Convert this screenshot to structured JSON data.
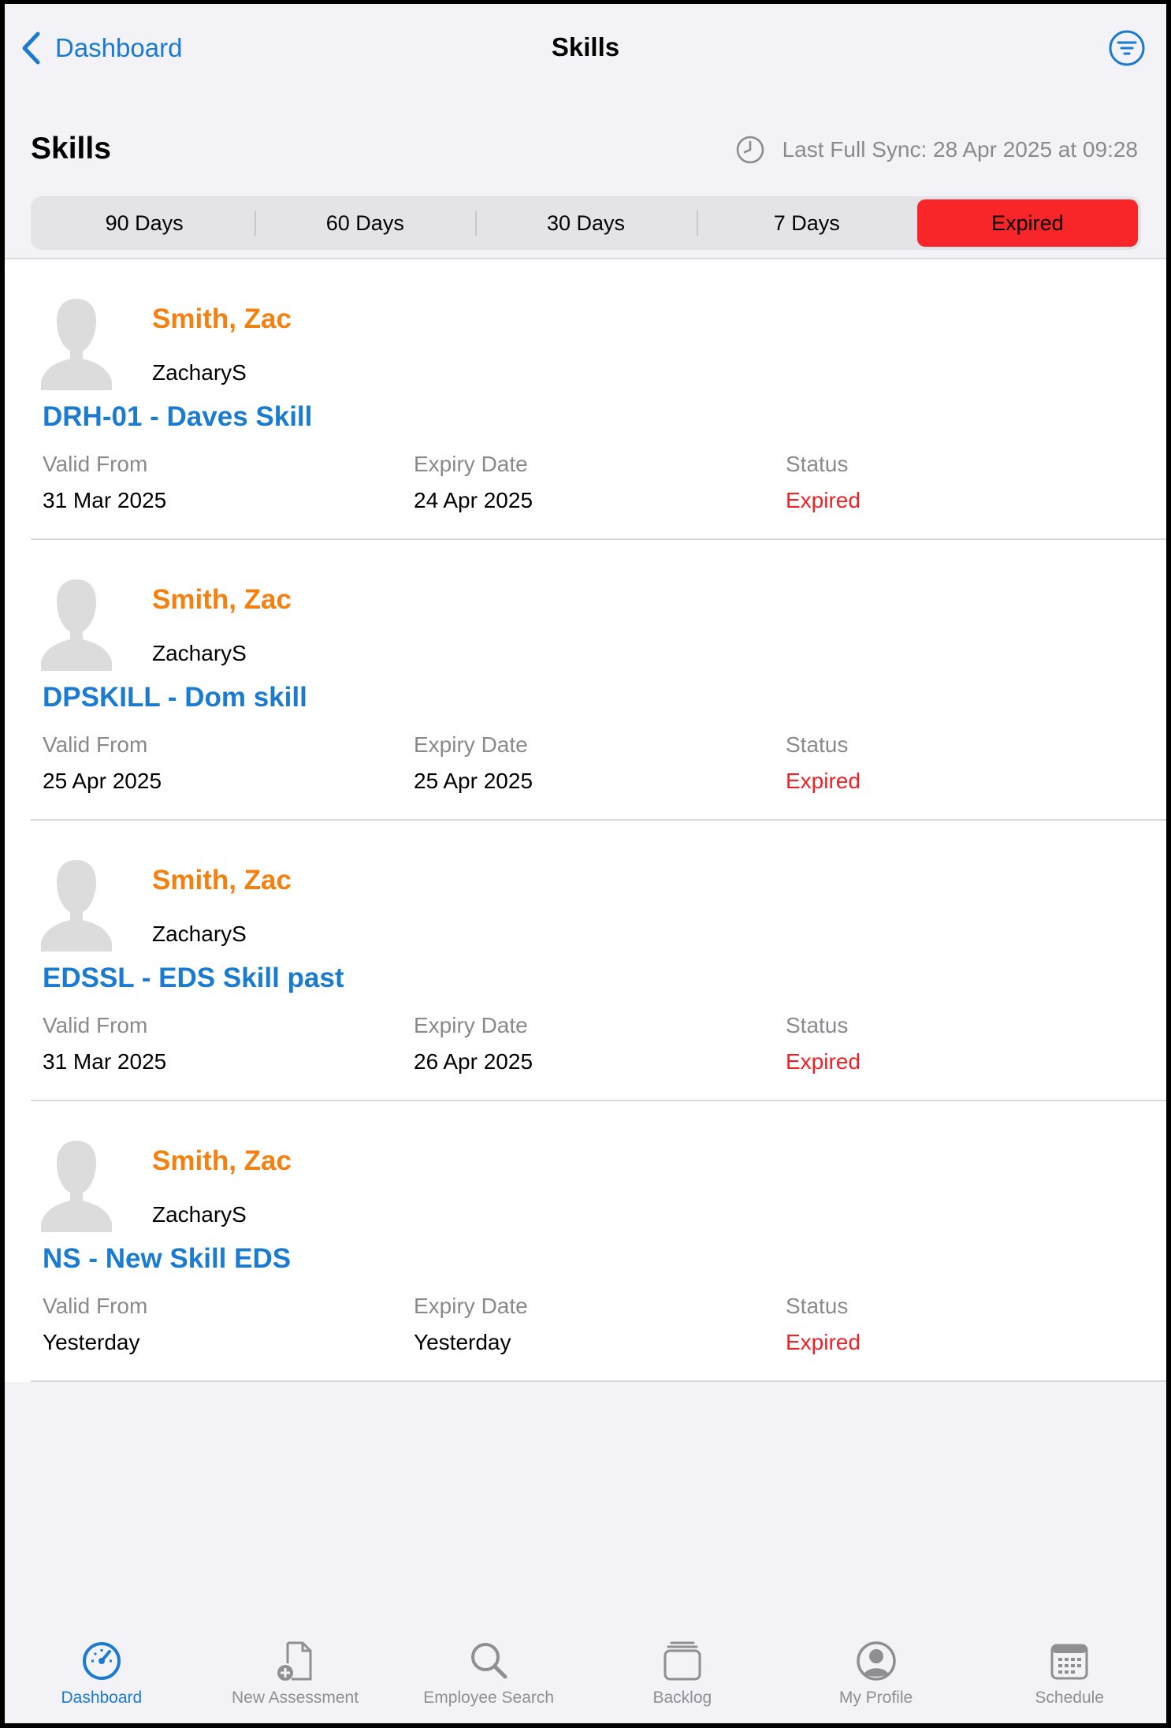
{
  "nav": {
    "back_label": "Dashboard",
    "title": "Skills"
  },
  "header": {
    "title": "Skills",
    "sync_text": "Last Full Sync: 28 Apr 2025 at 09:28"
  },
  "segments": [
    "90 Days",
    "60 Days",
    "30 Days",
    "7 Days",
    "Expired"
  ],
  "selected_segment": "Expired",
  "columns": {
    "valid_from": "Valid From",
    "expiry_date": "Expiry Date",
    "status": "Status"
  },
  "skills": [
    {
      "name": "Smith, Zac",
      "username": "ZacharyS",
      "skill": "DRH-01 - Daves Skill",
      "valid_from": "31 Mar 2025",
      "expiry": "24 Apr 2025",
      "status": "Expired"
    },
    {
      "name": "Smith, Zac",
      "username": "ZacharyS",
      "skill": "DPSKILL - Dom skill",
      "valid_from": "25 Apr 2025",
      "expiry": "25 Apr 2025",
      "status": "Expired"
    },
    {
      "name": "Smith, Zac",
      "username": "ZacharyS",
      "skill": "EDSSL - EDS Skill past",
      "valid_from": "31 Mar 2025",
      "expiry": "26 Apr 2025",
      "status": "Expired"
    },
    {
      "name": "Smith, Zac",
      "username": "ZacharyS",
      "skill": "NS - New Skill EDS",
      "valid_from": "Yesterday",
      "expiry": "Yesterday",
      "status": "Expired"
    }
  ],
  "tabs": [
    {
      "label": "Dashboard",
      "icon": "gauge-icon"
    },
    {
      "label": "New Assessment",
      "icon": "document-add-icon"
    },
    {
      "label": "Employee Search",
      "icon": "search-icon"
    },
    {
      "label": "Backlog",
      "icon": "stack-icon"
    },
    {
      "label": "My Profile",
      "icon": "person-circle-icon"
    },
    {
      "label": "Schedule",
      "icon": "calendar-icon"
    }
  ],
  "active_tab": "Dashboard",
  "colors": {
    "accent": "#1a7bd0",
    "name_orange": "#f4810f",
    "expired_red": "#f21f25",
    "active_segment": "#f82628"
  }
}
